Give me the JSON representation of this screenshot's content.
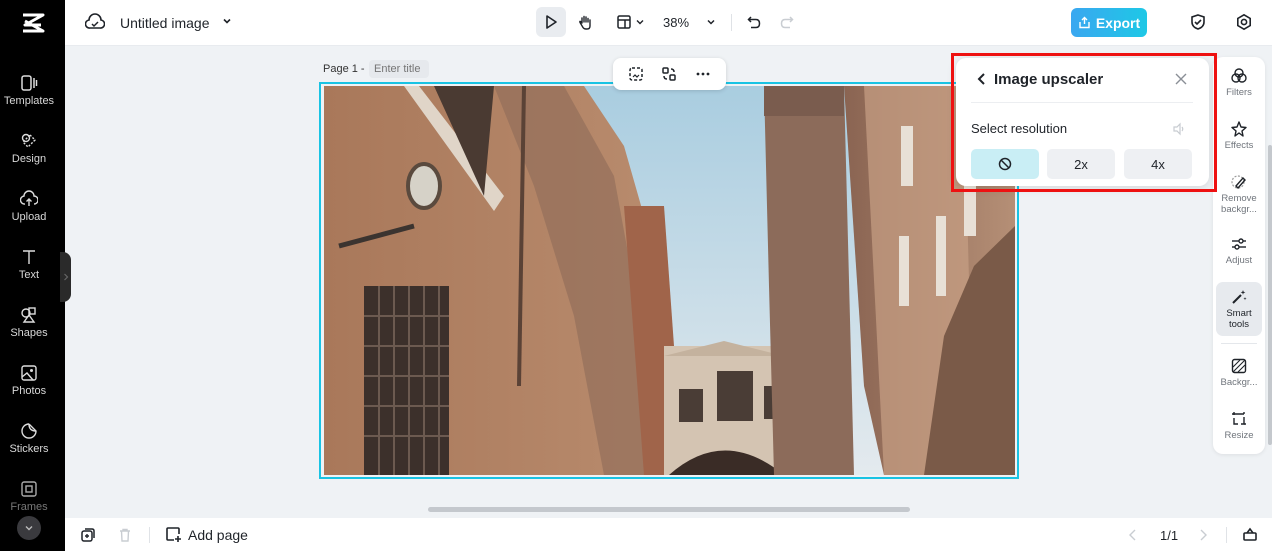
{
  "app": {
    "logo": "capcut-logo",
    "document_title": "Untitled image"
  },
  "sidebar": {
    "items": [
      {
        "label": "Templates",
        "icon": "templates-icon"
      },
      {
        "label": "Design",
        "icon": "design-icon"
      },
      {
        "label": "Upload",
        "icon": "upload-icon"
      },
      {
        "label": "Text",
        "icon": "text-icon"
      },
      {
        "label": "Shapes",
        "icon": "shapes-icon"
      },
      {
        "label": "Photos",
        "icon": "photos-icon"
      },
      {
        "label": "Stickers",
        "icon": "stickers-icon"
      },
      {
        "label": "Frames",
        "icon": "frames-icon"
      }
    ]
  },
  "toolbar": {
    "zoom_level": "38%",
    "export_label": "Export"
  },
  "canvas": {
    "page_label": "Page 1 -",
    "title_placeholder": "Enter title",
    "image_description": "Narrow street with ochre stone buildings and an arched bridge under a pale sky"
  },
  "right_panel": {
    "items": [
      {
        "label": "Filters",
        "icon": "filters-icon"
      },
      {
        "label": "Effects",
        "icon": "effects-icon"
      },
      {
        "label": "Remove backgr...",
        "icon": "remove-background-icon"
      },
      {
        "label": "Adjust",
        "icon": "adjust-icon"
      },
      {
        "label": "Smart tools",
        "icon": "smart-tools-icon",
        "active": true
      },
      {
        "label": "Backgr...",
        "icon": "background-icon"
      },
      {
        "label": "Resize",
        "icon": "resize-icon"
      }
    ]
  },
  "upscaler": {
    "title": "Image upscaler",
    "section_label": "Select resolution",
    "options": [
      {
        "label": "none",
        "icon": "no-symbol-icon",
        "selected": true
      },
      {
        "label": "2x",
        "selected": false
      },
      {
        "label": "4x",
        "selected": false
      }
    ]
  },
  "bottombar": {
    "add_page_label": "Add page",
    "page_indicator": "1/1"
  }
}
